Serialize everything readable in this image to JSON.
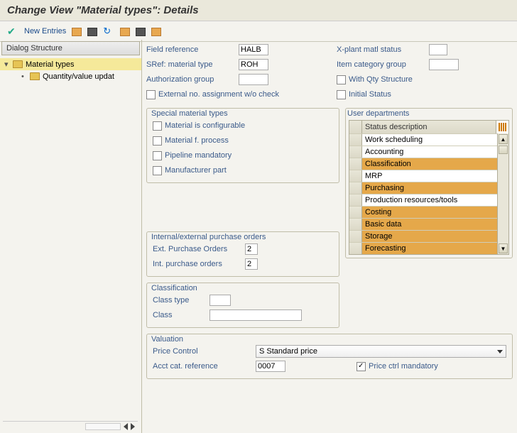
{
  "title": "Change View \"Material types\": Details",
  "toolbar": {
    "new_entries": "New Entries"
  },
  "tree": {
    "title": "Dialog Structure",
    "item1": "Material types",
    "item2": "Quantity/value updat"
  },
  "top": {
    "field_ref_lbl": "Field reference",
    "field_ref_val": "HALB",
    "sref_lbl": "SRef: material type",
    "sref_val": "ROH",
    "auth_lbl": "Authorization group",
    "ext_no_lbl": "External no. assignment w/o check",
    "xplant_lbl": "X-plant matl status",
    "itemcat_lbl": "Item category group",
    "withqty_lbl": "With Qty Structure",
    "initstat_lbl": "Initial Status"
  },
  "special": {
    "title": "Special material types",
    "configurable": "Material is configurable",
    "process": "Material f. process",
    "pipeline": "Pipeline mandatory",
    "manuf": "Manufacturer part"
  },
  "user_dept": {
    "title": "User departments",
    "header": "Status description",
    "rows": [
      "Work scheduling",
      "Accounting",
      "Classification",
      "MRP",
      "Purchasing",
      "Production resources/tools",
      "Costing",
      "Basic data",
      "Storage",
      "Forecasting"
    ],
    "selected": [
      2,
      4,
      6,
      7,
      8,
      9
    ]
  },
  "purchase": {
    "title": "Internal/external purchase orders",
    "ext_lbl": "Ext. Purchase Orders",
    "ext_val": "2",
    "int_lbl": "Int. purchase orders",
    "int_val": "2"
  },
  "classification": {
    "title": "Classification",
    "ctype_lbl": "Class type",
    "class_lbl": "Class"
  },
  "valuation": {
    "title": "Valuation",
    "price_ctrl_lbl": "Price Control",
    "price_ctrl_val": "S Standard price",
    "acct_lbl": "Acct cat. reference",
    "acct_val": "0007",
    "mand_lbl": "Price ctrl mandatory"
  }
}
